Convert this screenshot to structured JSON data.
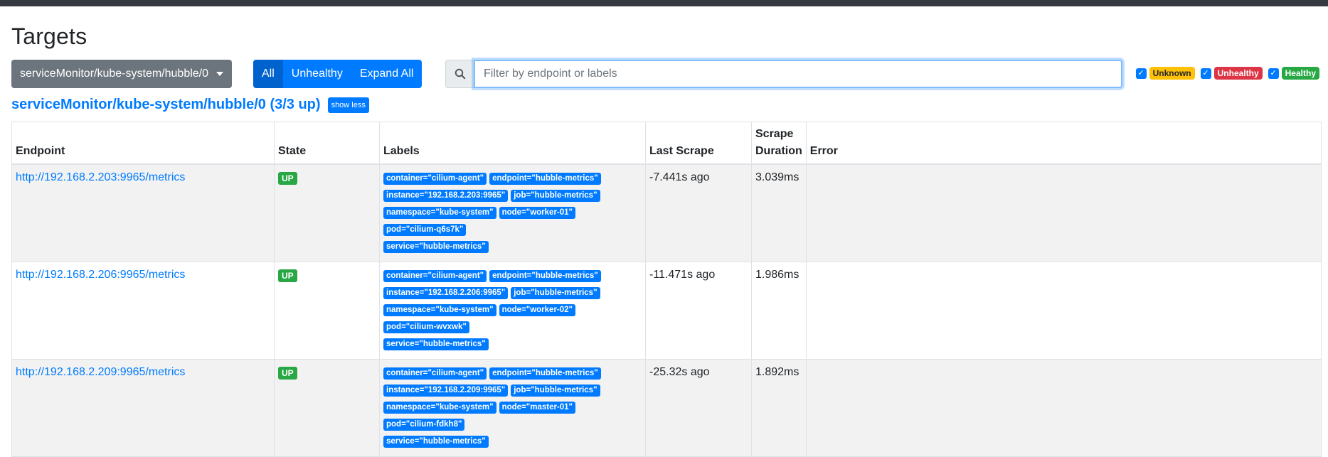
{
  "page": {
    "title": "Targets"
  },
  "controls": {
    "dropdown_label": "serviceMonitor/kube-system/hubble/0",
    "buttons": {
      "all": "All",
      "unhealthy": "Unhealthy",
      "expand_all": "Expand All"
    },
    "search_placeholder": "Filter by endpoint or labels",
    "filters": {
      "unknown": "Unknown",
      "unhealthy": "Unhealthy",
      "healthy": "Healthy"
    }
  },
  "section": {
    "title": "serviceMonitor/kube-system/hubble/0 (3/3 up)",
    "toggle_label": "show less"
  },
  "table": {
    "headers": {
      "endpoint": "Endpoint",
      "state": "State",
      "labels": "Labels",
      "last_scrape": "Last Scrape",
      "scrape_duration": "Scrape Duration",
      "error": "Error"
    },
    "rows": [
      {
        "endpoint": "http://192.168.2.203:9965/metrics",
        "state": "UP",
        "labels": [
          "container=\"cilium-agent\"",
          "endpoint=\"hubble-metrics\"",
          "instance=\"192.168.2.203:9965\"",
          "job=\"hubble-metrics\"",
          "namespace=\"kube-system\"",
          "node=\"worker-01\"",
          "pod=\"cilium-q6s7k\"",
          "service=\"hubble-metrics\""
        ],
        "last_scrape": "-7.441s ago",
        "scrape_duration": "3.039ms",
        "error": ""
      },
      {
        "endpoint": "http://192.168.2.206:9965/metrics",
        "state": "UP",
        "labels": [
          "container=\"cilium-agent\"",
          "endpoint=\"hubble-metrics\"",
          "instance=\"192.168.2.206:9965\"",
          "job=\"hubble-metrics\"",
          "namespace=\"kube-system\"",
          "node=\"worker-02\"",
          "pod=\"cilium-wvxwk\"",
          "service=\"hubble-metrics\""
        ],
        "last_scrape": "-11.471s ago",
        "scrape_duration": "1.986ms",
        "error": ""
      },
      {
        "endpoint": "http://192.168.2.209:9965/metrics",
        "state": "UP",
        "labels": [
          "container=\"cilium-agent\"",
          "endpoint=\"hubble-metrics\"",
          "instance=\"192.168.2.209:9965\"",
          "job=\"hubble-metrics\"",
          "namespace=\"kube-system\"",
          "node=\"master-01\"",
          "pod=\"cilium-fdkh8\"",
          "service=\"hubble-metrics\""
        ],
        "last_scrape": "-25.32s ago",
        "scrape_duration": "1.892ms",
        "error": ""
      }
    ]
  },
  "colors": {
    "primary": "#007bff",
    "success": "#28a745",
    "danger": "#dc3545",
    "warning": "#ffc107",
    "secondary": "#6c757d",
    "navbar": "#343a40"
  }
}
